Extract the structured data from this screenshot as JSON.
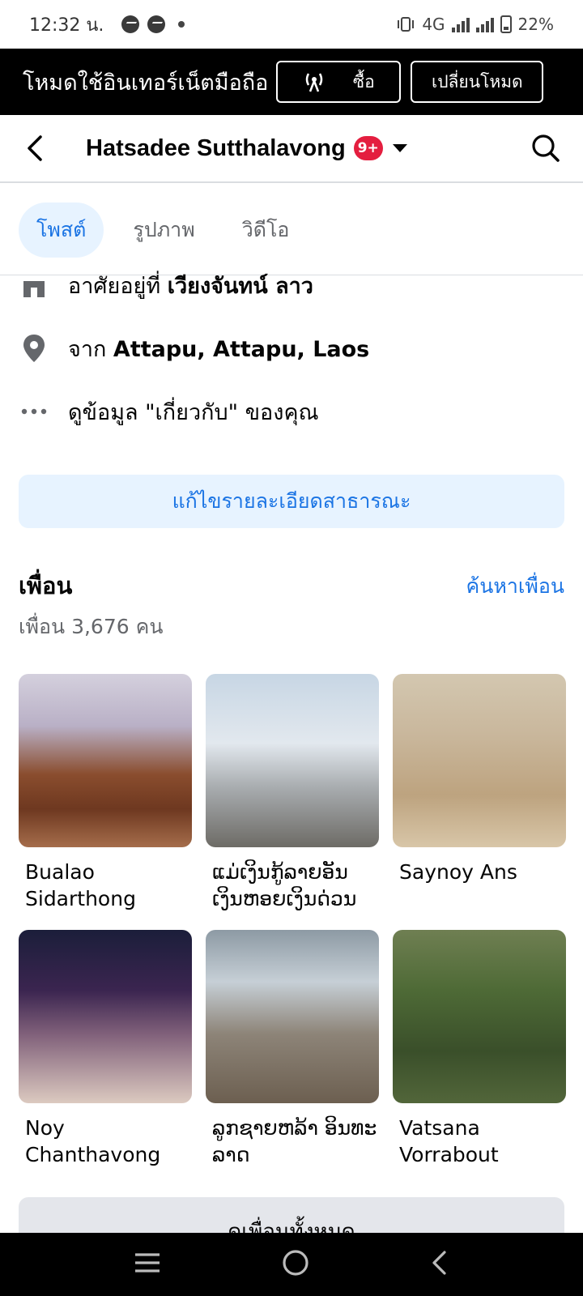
{
  "status_bar": {
    "time": "12:32 น.",
    "network": "4G",
    "battery": "22%"
  },
  "data_banner": {
    "title": "โหมดใช้อินเทอร์เน็ตมือถือ",
    "buy_label": "ซื้อ",
    "switch_label": "เปลี่ยนโหมด"
  },
  "header": {
    "profile_name": "Hatsadee Sutthalavong",
    "badge": "9+"
  },
  "tabs": [
    {
      "label": "โพสต์",
      "active": true
    },
    {
      "label": "รูปภาพ",
      "active": false
    },
    {
      "label": "วิดีโอ",
      "active": false
    }
  ],
  "about": {
    "lives_prefix": "อาศัยอยู่ที่ ",
    "lives_value": "เวียงจันทน์ ลาว",
    "from_prefix": "จาก ",
    "from_value": "Attapu, Attapu, Laos",
    "see_about": "ดูข้อมูล \"เกี่ยวกับ\" ของคุณ"
  },
  "edit_public_details": "แก้ไขรายละเอียดสาธารณะ",
  "friends": {
    "title": "เพื่อน",
    "find_friends": "ค้นหาเพื่อน",
    "count": "เพื่อน 3,676 คน",
    "items": [
      {
        "name": "Bualao Sidarthong"
      },
      {
        "name": "ແມ່ເງິນກູ້ລາຍອັນ ເງິນຫອຍເງິນດ່ວນ"
      },
      {
        "name": "Saynoy Ans"
      },
      {
        "name": "Noy Chanthavong"
      },
      {
        "name": "ລູກຊາຍຫລ້າ ອິນທະລາດ"
      },
      {
        "name": "Vatsana Vorrabout"
      }
    ],
    "see_all": "ดูเพื่อนทั้งหมด"
  },
  "colors": {
    "accent": "#1b74e4",
    "accent_bg": "#e7f3ff",
    "badge": "#e41e3f"
  }
}
